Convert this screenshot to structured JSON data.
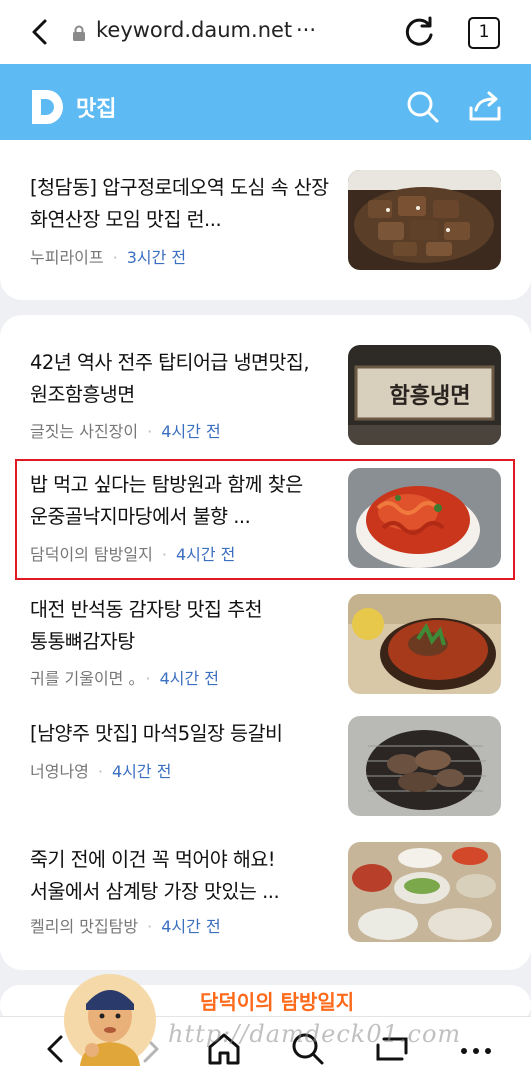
{
  "browser": {
    "url": "keyword.daum.net",
    "url_more": "···",
    "tab_count": "1"
  },
  "header": {
    "title": "맛집"
  },
  "colors": {
    "header_bg": "#5dbaf3",
    "time_text": "#3b6fc0",
    "highlight_border": "#e01a22"
  },
  "articles": [
    {
      "title": "[청담동] 압구정로데오역 도심 속 산장 화연산장 모임 맛집 런...",
      "source": "누피라이프",
      "time": "3시간 전"
    },
    {
      "title": "42년 역사 전주 탑티어급 냉면맛집, 원조함흥냉면",
      "source": "글짓는 사진장이",
      "time": "4시간 전",
      "thumb_text": "함흥냉면"
    },
    {
      "title": "밥 먹고 싶다는 탐방원과 함께 찾은 운중골낙지마당에서 불향 ...",
      "source": "담덕이의 탐방일지",
      "time": "4시간 전"
    },
    {
      "title": "대전 반석동 감자탕 맛집 추천 통통뼈감자탕",
      "source": "귀를 기울이면 。",
      "time": "4시간 전"
    },
    {
      "title": "[남양주 맛집] 마석5일장 등갈비",
      "source": "너영나영",
      "time": "4시간 전"
    },
    {
      "title": "죽기 전에 이건 꼭 먹어야 해요! 서울에서 삼계탕 가장 맛있는 ...",
      "source": "켈리의 맛집탐방",
      "time": "4시간 전"
    }
  ],
  "watermark": {
    "name": "담덕이의 탐방일지",
    "url": "http://damdeck01.com"
  },
  "icons": {
    "browser_back": "chevron-left-icon",
    "lock": "lock-icon",
    "reload": "reload-icon",
    "search": "search-icon",
    "share": "share-icon",
    "nav_back": "chevron-left-icon",
    "nav_home": "home-icon",
    "nav_search": "search-icon",
    "nav_tabs": "tabs-icon",
    "nav_more": "more-icon"
  }
}
